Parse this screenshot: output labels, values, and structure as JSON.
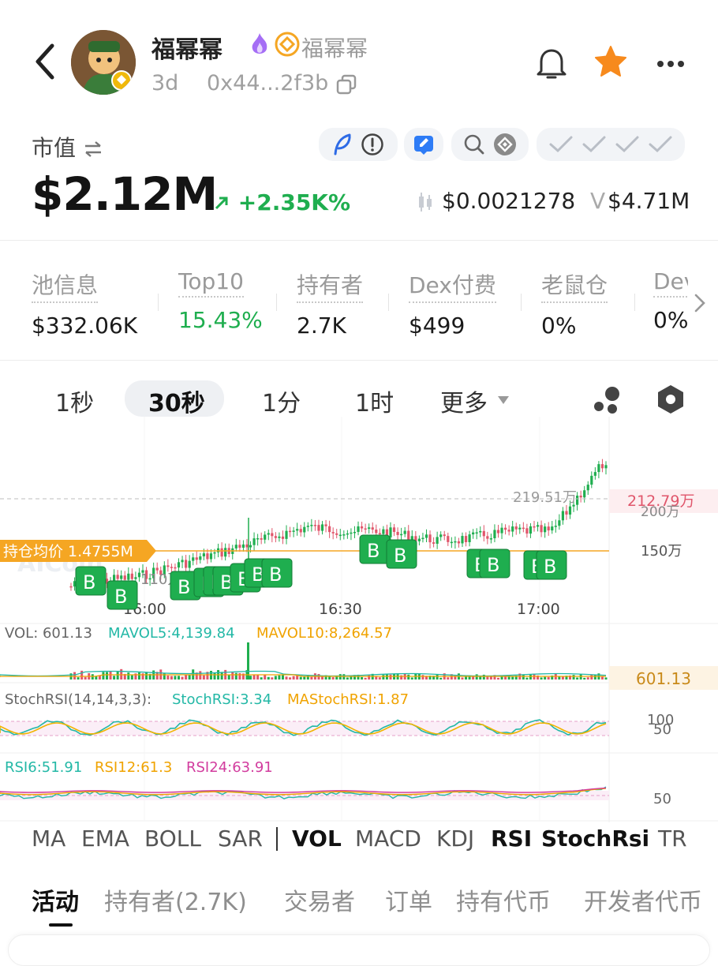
{
  "token": {
    "name": "福幂幂",
    "alias": "福幂幂",
    "age": "3d",
    "address": "0x44...2f3b"
  },
  "market": {
    "label": "市值",
    "value": "$2.12M",
    "change": "+2.35K%",
    "price": "$0.0021278",
    "volume_label": "V",
    "volume": "$4.71M"
  },
  "stats": [
    {
      "label": "池信息",
      "value": "$332.06K"
    },
    {
      "label": "Top10",
      "value": "15.43%"
    },
    {
      "label": "持有者",
      "value": "2.7K"
    },
    {
      "label": "Dex付费",
      "value": "$499"
    },
    {
      "label": "老鼠仓",
      "value": "0%"
    },
    {
      "label": "Dev",
      "value": "0%"
    }
  ],
  "timeframes": {
    "items": [
      "1秒",
      "30秒",
      "1分",
      "1时",
      "更多"
    ],
    "selected": "30秒"
  },
  "chart": {
    "high_label": "219.51万",
    "current_price_label": "212.79万",
    "axis_200": "200万",
    "axis_150": "150万",
    "low_label": "110万",
    "avg_cost_label": "持仓均价 1.4755M",
    "x_ticks": [
      "16:00",
      "16:30",
      "17:00"
    ],
    "buy_marker": "B",
    "watermark": "AICoin",
    "vol_line": {
      "vol": "VOL: 601.13",
      "ma5": "MAVOL5:4,139.84",
      "ma10": "MAVOL10:8,264.57"
    },
    "vol_current": "601.13",
    "stoch_line": {
      "title": "StochRSI(14,14,3,3):",
      "k": "StochRSI:3.34",
      "d": "MAStochRSI:1.87"
    },
    "stoch_axis": [
      "100",
      "50"
    ],
    "rsi_line": {
      "r6": "RSI6:51.91",
      "r12": "RSI12:61.3",
      "r24": "RSI24:63.91"
    },
    "rsi_axis": "50",
    "colors": {
      "up": "#1fae4f",
      "down": "#e0566b",
      "avg": "#f5a623",
      "k": "#23b8a6",
      "d": "#f0b400",
      "rsi24": "#d23c9e"
    }
  },
  "indicators": [
    "MA",
    "EMA",
    "BOLL",
    "SAR",
    "VOL",
    "MACD",
    "KDJ",
    "RSI",
    "StochRsi",
    "TR"
  ],
  "activity_tabs": [
    "活动",
    "持有者(2.7K)",
    "交易者",
    "订单",
    "持有代币",
    "开发者代币"
  ]
}
